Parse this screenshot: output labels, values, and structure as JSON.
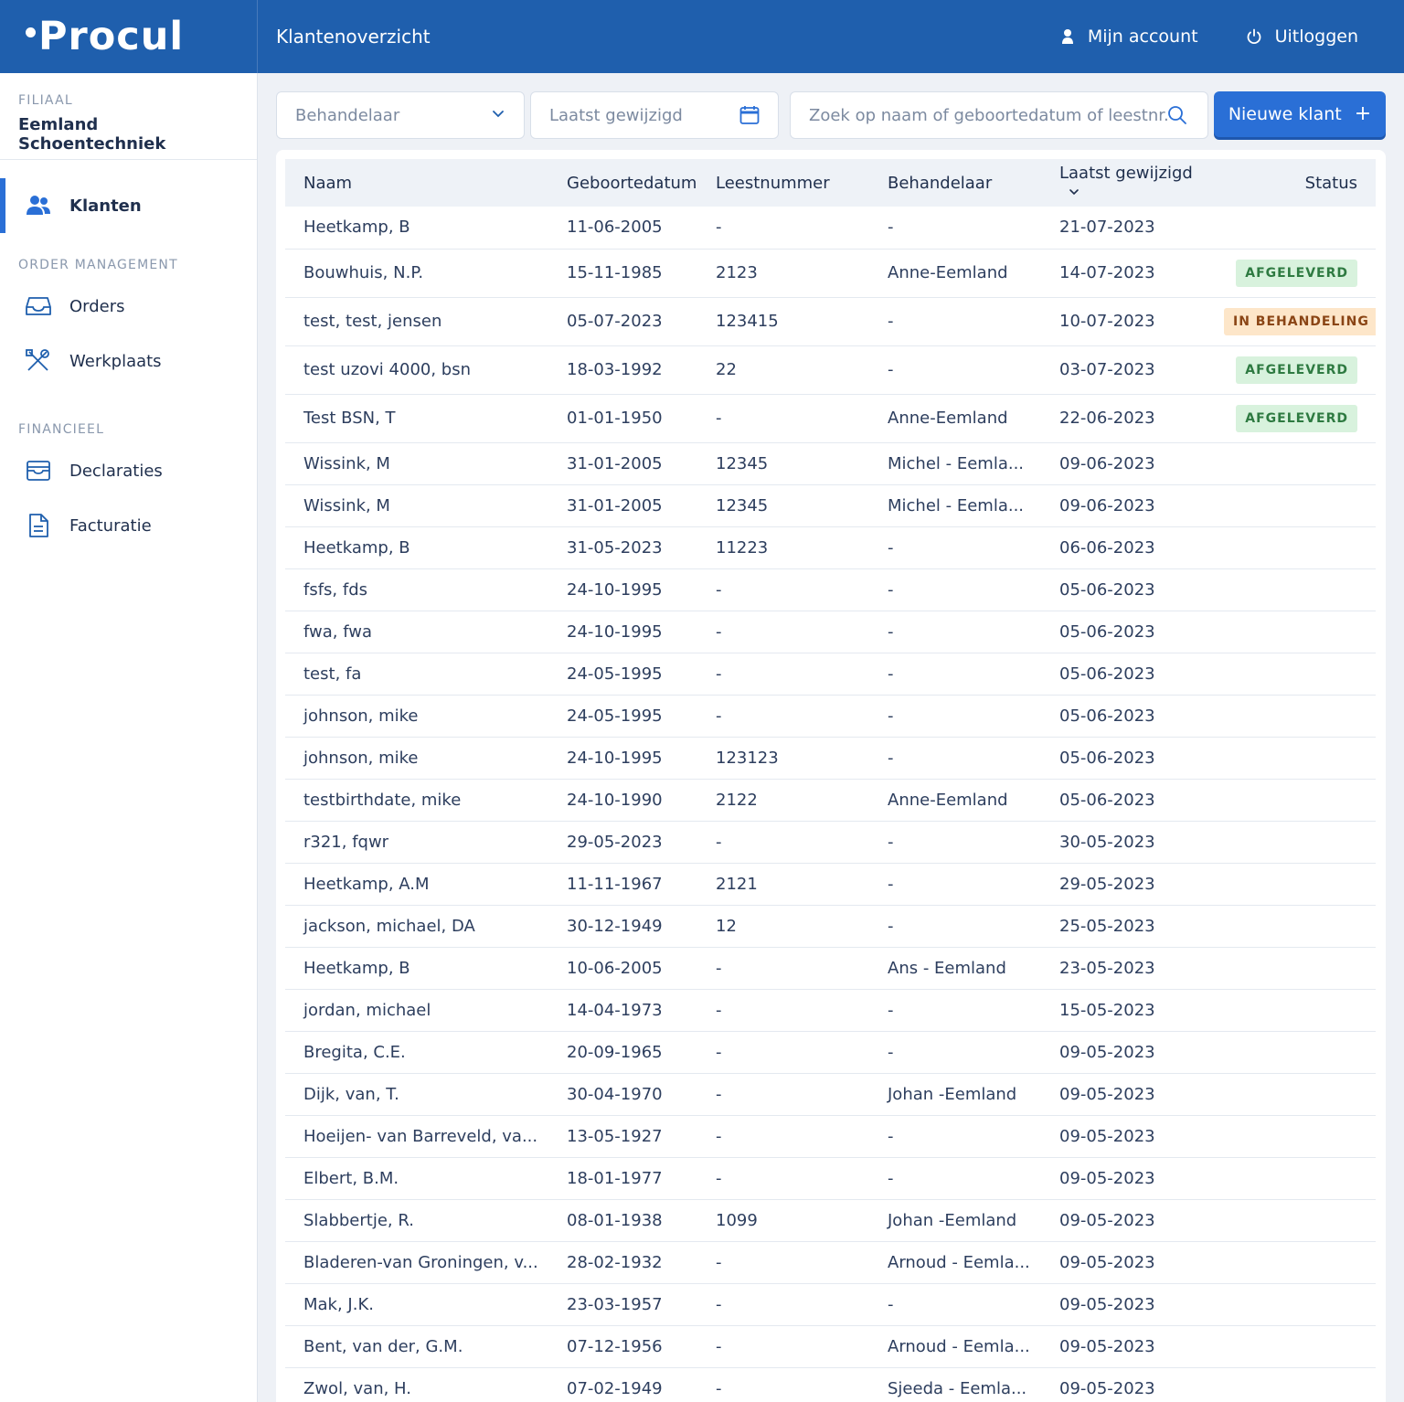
{
  "app": {
    "logo_text": "Procul",
    "page_title": "Klantenoverzicht",
    "account_label": "Mijn account",
    "logout_label": "Uitloggen",
    "brand_color": "#1f5fad",
    "accent_color": "#2a6fd6"
  },
  "sidebar": {
    "branch_label": "FILIAAL",
    "branch_name": "Eemland Schoentechniek",
    "items": [
      {
        "label": "Klanten",
        "icon": "users-icon",
        "active": true
      }
    ],
    "sections": [
      {
        "title": "ORDER MANAGEMENT",
        "items": [
          {
            "label": "Orders",
            "icon": "inbox-icon"
          },
          {
            "label": "Werkplaats",
            "icon": "tools-icon"
          }
        ]
      },
      {
        "title": "FINANCIEEL",
        "items": [
          {
            "label": "Declaraties",
            "icon": "archive-icon"
          },
          {
            "label": "Facturatie",
            "icon": "document-icon"
          }
        ]
      }
    ]
  },
  "toolbar": {
    "behandelaar_placeholder": "Behandelaar",
    "date_placeholder": "Laatst gewijzigd",
    "search_placeholder": "Zoek op naam of geboortedatum of leestnr.",
    "new_button_label": "Nieuwe klant"
  },
  "table": {
    "columns": [
      "Naam",
      "Geboortedatum",
      "Leestnummer",
      "Behandelaar",
      "Laatst gewijzigd",
      "Status"
    ],
    "rows": [
      {
        "naam": "Heetkamp, B",
        "geboortedatum": "11-06-2005",
        "leestnummer": "-",
        "behandelaar": "-",
        "gewijzigd": "21-07-2023",
        "status": ""
      },
      {
        "naam": "Bouwhuis, N.P.",
        "geboortedatum": "15-11-1985",
        "leestnummer": "2123",
        "behandelaar": "Anne-Eemland",
        "gewijzigd": "14-07-2023",
        "status": "AFGELEVERD"
      },
      {
        "naam": "test, test, jensen",
        "geboortedatum": "05-07-2023",
        "leestnummer": "123415",
        "behandelaar": "-",
        "gewijzigd": "10-07-2023",
        "status": "IN BEHANDELING"
      },
      {
        "naam": "test uzovi 4000, bsn",
        "geboortedatum": "18-03-1992",
        "leestnummer": "22",
        "behandelaar": "-",
        "gewijzigd": "03-07-2023",
        "status": "AFGELEVERD"
      },
      {
        "naam": "Test BSN, T",
        "geboortedatum": "01-01-1950",
        "leestnummer": "-",
        "behandelaar": "Anne-Eemland",
        "gewijzigd": "22-06-2023",
        "status": "AFGELEVERD"
      },
      {
        "naam": "Wissink, M",
        "geboortedatum": "31-01-2005",
        "leestnummer": "12345",
        "behandelaar": "Michel - Eemla...",
        "gewijzigd": "09-06-2023",
        "status": ""
      },
      {
        "naam": "Wissink, M",
        "geboortedatum": "31-01-2005",
        "leestnummer": "12345",
        "behandelaar": "Michel - Eemla...",
        "gewijzigd": "09-06-2023",
        "status": ""
      },
      {
        "naam": "Heetkamp, B",
        "geboortedatum": "31-05-2023",
        "leestnummer": "11223",
        "behandelaar": "-",
        "gewijzigd": "06-06-2023",
        "status": ""
      },
      {
        "naam": "fsfs, fds",
        "geboortedatum": "24-10-1995",
        "leestnummer": "-",
        "behandelaar": "-",
        "gewijzigd": "05-06-2023",
        "status": ""
      },
      {
        "naam": "fwa, fwa",
        "geboortedatum": "24-10-1995",
        "leestnummer": "-",
        "behandelaar": "-",
        "gewijzigd": "05-06-2023",
        "status": ""
      },
      {
        "naam": "test, fa",
        "geboortedatum": "24-05-1995",
        "leestnummer": "-",
        "behandelaar": "-",
        "gewijzigd": "05-06-2023",
        "status": ""
      },
      {
        "naam": "johnson, mike",
        "geboortedatum": "24-05-1995",
        "leestnummer": "-",
        "behandelaar": "-",
        "gewijzigd": "05-06-2023",
        "status": ""
      },
      {
        "naam": "johnson, mike",
        "geboortedatum": "24-10-1995",
        "leestnummer": "123123",
        "behandelaar": "-",
        "gewijzigd": "05-06-2023",
        "status": ""
      },
      {
        "naam": "testbirthdate, mike",
        "geboortedatum": "24-10-1990",
        "leestnummer": "2122",
        "behandelaar": "Anne-Eemland",
        "gewijzigd": "05-06-2023",
        "status": ""
      },
      {
        "naam": "r321, fqwr",
        "geboortedatum": "29-05-2023",
        "leestnummer": "-",
        "behandelaar": "-",
        "gewijzigd": "30-05-2023",
        "status": ""
      },
      {
        "naam": "Heetkamp, A.M",
        "geboortedatum": "11-11-1967",
        "leestnummer": "2121",
        "behandelaar": "-",
        "gewijzigd": "29-05-2023",
        "status": ""
      },
      {
        "naam": "jackson, michael, DA",
        "geboortedatum": "30-12-1949",
        "leestnummer": "12",
        "behandelaar": "-",
        "gewijzigd": "25-05-2023",
        "status": ""
      },
      {
        "naam": "Heetkamp, B",
        "geboortedatum": "10-06-2005",
        "leestnummer": "-",
        "behandelaar": "Ans - Eemland",
        "gewijzigd": "23-05-2023",
        "status": ""
      },
      {
        "naam": "jordan, michael",
        "geboortedatum": "14-04-1973",
        "leestnummer": "-",
        "behandelaar": "-",
        "gewijzigd": "15-05-2023",
        "status": ""
      },
      {
        "naam": "Bregita, C.E.",
        "geboortedatum": "20-09-1965",
        "leestnummer": "-",
        "behandelaar": "-",
        "gewijzigd": "09-05-2023",
        "status": ""
      },
      {
        "naam": "Dijk, van, T.",
        "geboortedatum": "30-04-1970",
        "leestnummer": "-",
        "behandelaar": "Johan -Eemland",
        "gewijzigd": "09-05-2023",
        "status": ""
      },
      {
        "naam": "Hoeijen- van Barreveld, va...",
        "geboortedatum": "13-05-1927",
        "leestnummer": "-",
        "behandelaar": "-",
        "gewijzigd": "09-05-2023",
        "status": ""
      },
      {
        "naam": "Elbert, B.M.",
        "geboortedatum": "18-01-1977",
        "leestnummer": "-",
        "behandelaar": "-",
        "gewijzigd": "09-05-2023",
        "status": ""
      },
      {
        "naam": "Slabbertje, R.",
        "geboortedatum": "08-01-1938",
        "leestnummer": "1099",
        "behandelaar": "Johan -Eemland",
        "gewijzigd": "09-05-2023",
        "status": ""
      },
      {
        "naam": "Bladeren-van Groningen, v...",
        "geboortedatum": "28-02-1932",
        "leestnummer": "-",
        "behandelaar": "Arnoud - Eemla...",
        "gewijzigd": "09-05-2023",
        "status": ""
      },
      {
        "naam": "Mak, J.K.",
        "geboortedatum": "23-03-1957",
        "leestnummer": "-",
        "behandelaar": "-",
        "gewijzigd": "09-05-2023",
        "status": ""
      },
      {
        "naam": "Bent, van der, G.M.",
        "geboortedatum": "07-12-1956",
        "leestnummer": "-",
        "behandelaar": "Arnoud - Eemla...",
        "gewijzigd": "09-05-2023",
        "status": ""
      },
      {
        "naam": "Zwol, van, H.",
        "geboortedatum": "07-02-1949",
        "leestnummer": "-",
        "behandelaar": "Sjeeda - Eemla...",
        "gewijzigd": "09-05-2023",
        "status": ""
      }
    ]
  }
}
